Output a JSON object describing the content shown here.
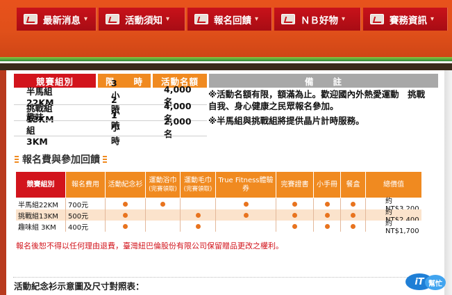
{
  "nav": {
    "items": [
      {
        "label": "最新消息",
        "marker": "▾"
      },
      {
        "label": "活動須知",
        "marker": "▾"
      },
      {
        "label": "報名回饋",
        "marker": "▾"
      },
      {
        "label": "ＮＢ好物",
        "marker": "▾"
      },
      {
        "label": "賽務資訊",
        "marker": "▾"
      }
    ]
  },
  "colors": {
    "nav_red": "#c8121a",
    "header_red": "#d2141c",
    "header_orange": "#f08a20",
    "header_gray": "#a8a8a8",
    "row_peach": "#fbe3cc",
    "dot_orange": "#e8731e",
    "warning_red": "#d2141c"
  },
  "group_table": {
    "headers": [
      "競賽組別",
      "限　　時",
      "活動名額",
      "備　　註"
    ],
    "rows": [
      {
        "group": "半馬組22KM",
        "limit": "3小時",
        "quota": "4,000名"
      },
      {
        "group": "挑戰組13KM",
        "limit": "2小時",
        "quota": "4,000名"
      },
      {
        "group": "趣味組  3KM",
        "limit": "1小時",
        "quota": "2,000名"
      }
    ],
    "notes": [
      "※活動名額有限，額滿為止。歡迎國內外熱愛運動　挑戰　自我、身心健康之民眾報名參加。",
      "※半馬組與挑戰組將提供晶片計時服務。"
    ]
  },
  "fee_section": {
    "title": "報名費與參加回饋"
  },
  "fee_table": {
    "headers": [
      {
        "line1": "競賽組別",
        "line2": ""
      },
      {
        "line1": "報名費用",
        "line2": ""
      },
      {
        "line1": "活動紀念衫",
        "line2": ""
      },
      {
        "line1": "運動浴巾",
        "line2": "(完賽領取)"
      },
      {
        "line1": "運動毛巾",
        "line2": "(完賽領取)"
      },
      {
        "line1": "True Fitness體驗券",
        "line2": ""
      },
      {
        "line1": "完賽證書",
        "line2": ""
      },
      {
        "line1": "小手冊",
        "line2": ""
      },
      {
        "line1": "餐盒",
        "line2": ""
      },
      {
        "line1": "總價值",
        "line2": ""
      }
    ],
    "rows": [
      {
        "group": "半馬組22KM",
        "fee": "700元",
        "marks": [
          true,
          true,
          false,
          true,
          true,
          true,
          true
        ],
        "total": "約NT$3,200"
      },
      {
        "group": "挑戰組13KM",
        "fee": "500元",
        "marks": [
          true,
          false,
          true,
          true,
          true,
          true,
          true
        ],
        "total": "約NT$2,400"
      },
      {
        "group": "趣味組  3KM",
        "fee": "400元",
        "marks": [
          true,
          false,
          true,
          false,
          true,
          true,
          true
        ],
        "total": "約NT$1,700"
      }
    ]
  },
  "warning": "報名後恕不得以任何理由退費，臺灣紐巴倫股份有限公司保留贈品更改之權利。",
  "shirt_title": "活動紀念衫示意圖及尺寸對照表：",
  "badge": {
    "text1": "iT",
    "text2": "幫忙"
  }
}
